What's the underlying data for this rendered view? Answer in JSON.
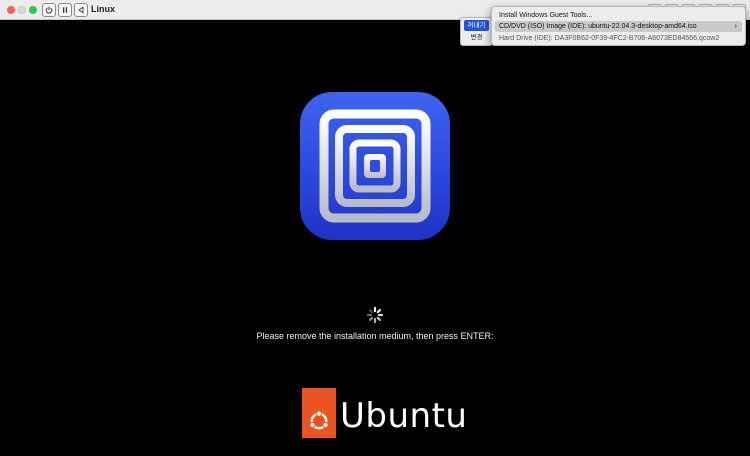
{
  "window": {
    "title": "Linux"
  },
  "side_menu": {
    "items": [
      "꺼내기",
      "변경"
    ]
  },
  "context_menu": {
    "items": [
      "Install Windows Guest Tools...",
      "CD/DVD (ISO) Image (IDE): ubuntu-22.04.3-desktop-amd64.iso",
      "Hard Drive (IDE): DA3F0B62-0F39-4FC2-B706-A6073ED84566.qcow2"
    ],
    "submenu_chevron": "›"
  },
  "screen": {
    "message": "Please remove the installation medium, then press ENTER:",
    "brand": "Ubuntu"
  },
  "colors": {
    "ubuntu_orange": "#e95420",
    "utm_blue": "#2b49de",
    "menu_selection": "#1f55d6"
  }
}
